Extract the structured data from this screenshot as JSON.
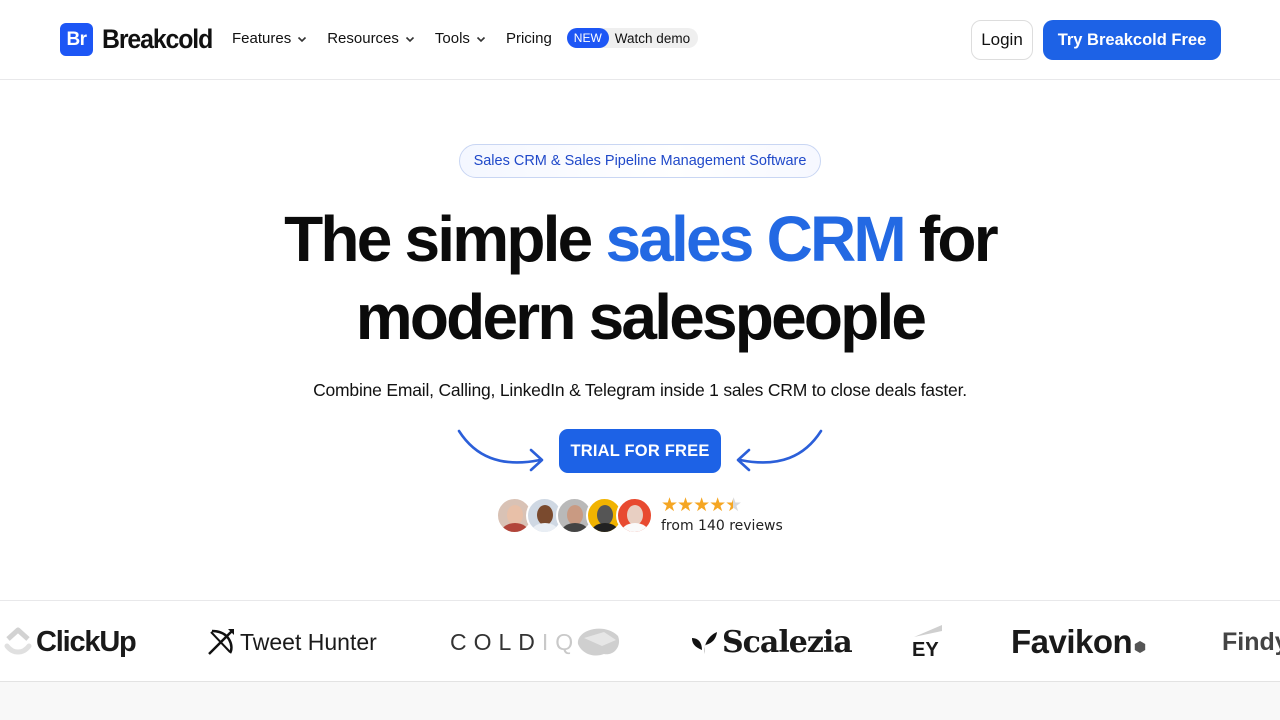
{
  "nav": {
    "logo_mark": "Br",
    "logo_text": "Breakcold",
    "links": [
      {
        "label": "Features",
        "has_dropdown": true
      },
      {
        "label": "Resources",
        "has_dropdown": true
      },
      {
        "label": "Tools",
        "has_dropdown": true
      },
      {
        "label": "Pricing",
        "has_dropdown": false
      }
    ],
    "new_badge": "NEW",
    "watch_demo": "Watch demo",
    "login": "Login",
    "try_free": "Try Breakcold Free"
  },
  "hero": {
    "tagline": "Sales CRM & Sales Pipeline Management Software",
    "headline_part1": "The simple ",
    "headline_accent": "sales CRM",
    "headline_part2": " for",
    "headline_line2": "modern salespeople",
    "subtitle": "Combine Email, Calling, LinkedIn & Telegram inside 1 sales CRM to close deals faster.",
    "cta": "TRIAL FOR FREE",
    "rating": 4.5,
    "rating_max": 5,
    "stars": "★★★★",
    "half_star": "★",
    "reviews_text": "from 140 reviews",
    "avatar_count": 5
  },
  "logos": {
    "clickup": "ClickUp",
    "tweet_hunter": "Tweet Hunter",
    "coldiq_main": "COLD",
    "coldiq_light": "IQ",
    "scalezia": "Scalezia",
    "ey": "EY",
    "favikon": "Favikon",
    "findy": "Findy"
  },
  "colors": {
    "brand_blue": "#1d56f5",
    "button_blue": "#1d62e6",
    "accent_text": "#2369e3",
    "star": "#f5a623"
  }
}
